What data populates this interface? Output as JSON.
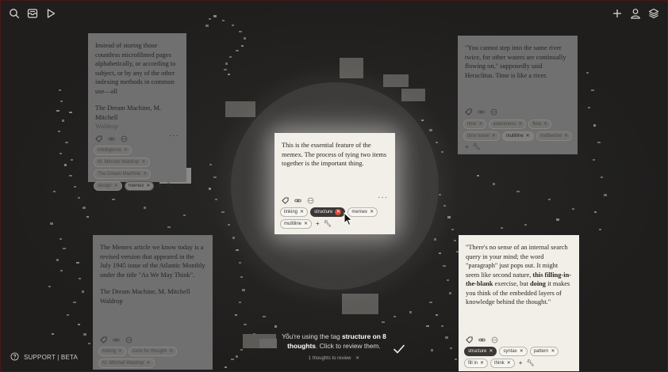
{
  "colors": {
    "background": "#1f1e1d",
    "frame": "#4a1717",
    "card_light": "#f2efe8",
    "card_dim": "#717070",
    "active_tag": "#3a3836",
    "delete_tag": "#d44a3a"
  },
  "header": {
    "left_icons": [
      "search-icon",
      "inbox-icon",
      "play-icon"
    ],
    "right_icons": [
      "plus-icon",
      "user-icon",
      "layers-icon"
    ]
  },
  "cards": {
    "top_left": {
      "text": "Instead of storing those countless microfilmed pages alphabetically, or according to subject, or by any of the other indexing methods in common use—all",
      "cite": "The Dream Machine, M. Mitchell",
      "cite2": "Waldrop",
      "tags": [
        "intelligence",
        "M. Mitchell Waldrop",
        "The Dream Machine",
        "design",
        "memex"
      ]
    },
    "top_right": {
      "text": "\"You cannot step into the same river twice, for other waters are continually flowing on,\" supposedly said Heraclitus. Time is like a river.",
      "tags": [
        "time",
        "awareness",
        "flow",
        "time travel",
        "multiline",
        "multiverse"
      ]
    },
    "center": {
      "text": "This is the essential feature of the memex. The process of tying two items together is the important thing.",
      "tags": [
        "linking",
        "structure",
        "memex",
        "multiline"
      ]
    },
    "bottom_left": {
      "text": "The Memex article we know today is a revised version that appeared in the July 1945 issue of the Atlantic Monthly under the title \"As We May Think\".",
      "cite": "The Dream Machine, M. Mitchell Waldrop",
      "tags": [
        "linking",
        "tools for thought",
        "M. Mitchell Waldrop"
      ]
    },
    "bottom_right": {
      "text_pre": "\"There's no sense of an internal search query in your mind; the word \"paragraph\" just pops out. It might seem like second nature, ",
      "text_bold1": "this filling-in-the-blank",
      "text_mid": " exercise, but ",
      "text_bold2": "doing",
      "text_post": " it makes you think of the embedded layers of knowledge behind the thought.\"",
      "tags": [
        "structure",
        "syntax",
        "pattern",
        "fill in",
        "think"
      ]
    }
  },
  "notice": {
    "pre": "You're using the tag ",
    "bold": "structure on 8 thoughts",
    "post": ". Click to review them.",
    "review": "1 thoughts to review"
  },
  "footer": {
    "support": "SUPPORT | BETA"
  }
}
